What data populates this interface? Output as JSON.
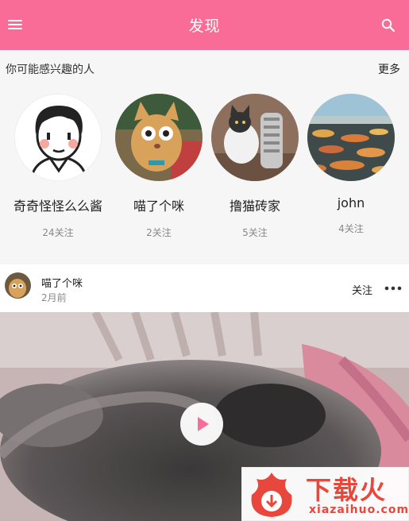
{
  "header": {
    "title": "发现",
    "menu_icon": "menu-icon",
    "search_icon": "search-icon",
    "accent": "#f86c97"
  },
  "recommend": {
    "title": "你可能感兴趣的人",
    "more_label": "更多",
    "users": [
      {
        "name": "奇奇怪怪么么酱",
        "followers": "24关注",
        "avatar": "cartoon-boy-avatar"
      },
      {
        "name": "喵了个咪",
        "followers": "2关注",
        "avatar": "kitten-avatar"
      },
      {
        "name": "撸猫砖家",
        "followers": "5关注",
        "avatar": "cat-heater-avatar"
      },
      {
        "name": "john",
        "followers": "4关注",
        "avatar": "landscape-avatar"
      }
    ]
  },
  "post": {
    "author": "喵了个咪",
    "time": "2月前",
    "follow_label": "关注",
    "more_icon": "more-dots-icon",
    "play_icon": "play-icon"
  },
  "watermark": {
    "title": "下载火",
    "domain": "xiazaihuo.com"
  }
}
